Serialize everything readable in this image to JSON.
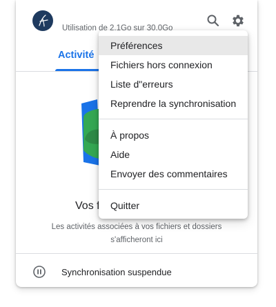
{
  "header": {
    "avatar_icon": "user-monogram-icon",
    "storage_text": "Utilisation de 2,1Go sur 30,0Go",
    "search_icon": "search-icon",
    "settings_icon": "gear-icon"
  },
  "tabs": [
    {
      "label": "Activité",
      "active": true
    }
  ],
  "empty_state": {
    "illustration_icon": "folder-illustration-icon",
    "title": "Vos f",
    "description": "Les activités associées à vos fichiers et dossiers s'afficheront ici"
  },
  "footer": {
    "status_icon": "pause-icon",
    "status_text": "Synchronisation suspendue"
  },
  "settings_menu": {
    "groups": [
      [
        "Préférences",
        "Fichiers hors connexion",
        "Liste d\"erreurs",
        "Reprendre la synchronisation"
      ],
      [
        "À propos",
        "Aide",
        "Envoyer des commentaires"
      ],
      [
        "Quitter"
      ]
    ],
    "highlighted": "Préférences"
  },
  "colors": {
    "accent": "#1a73e8",
    "avatar_bg": "#1e3a5f",
    "menu_highlight": "#e8e8e8",
    "illustration_blue": "#1a73e8",
    "illustration_green": "#34a853"
  }
}
